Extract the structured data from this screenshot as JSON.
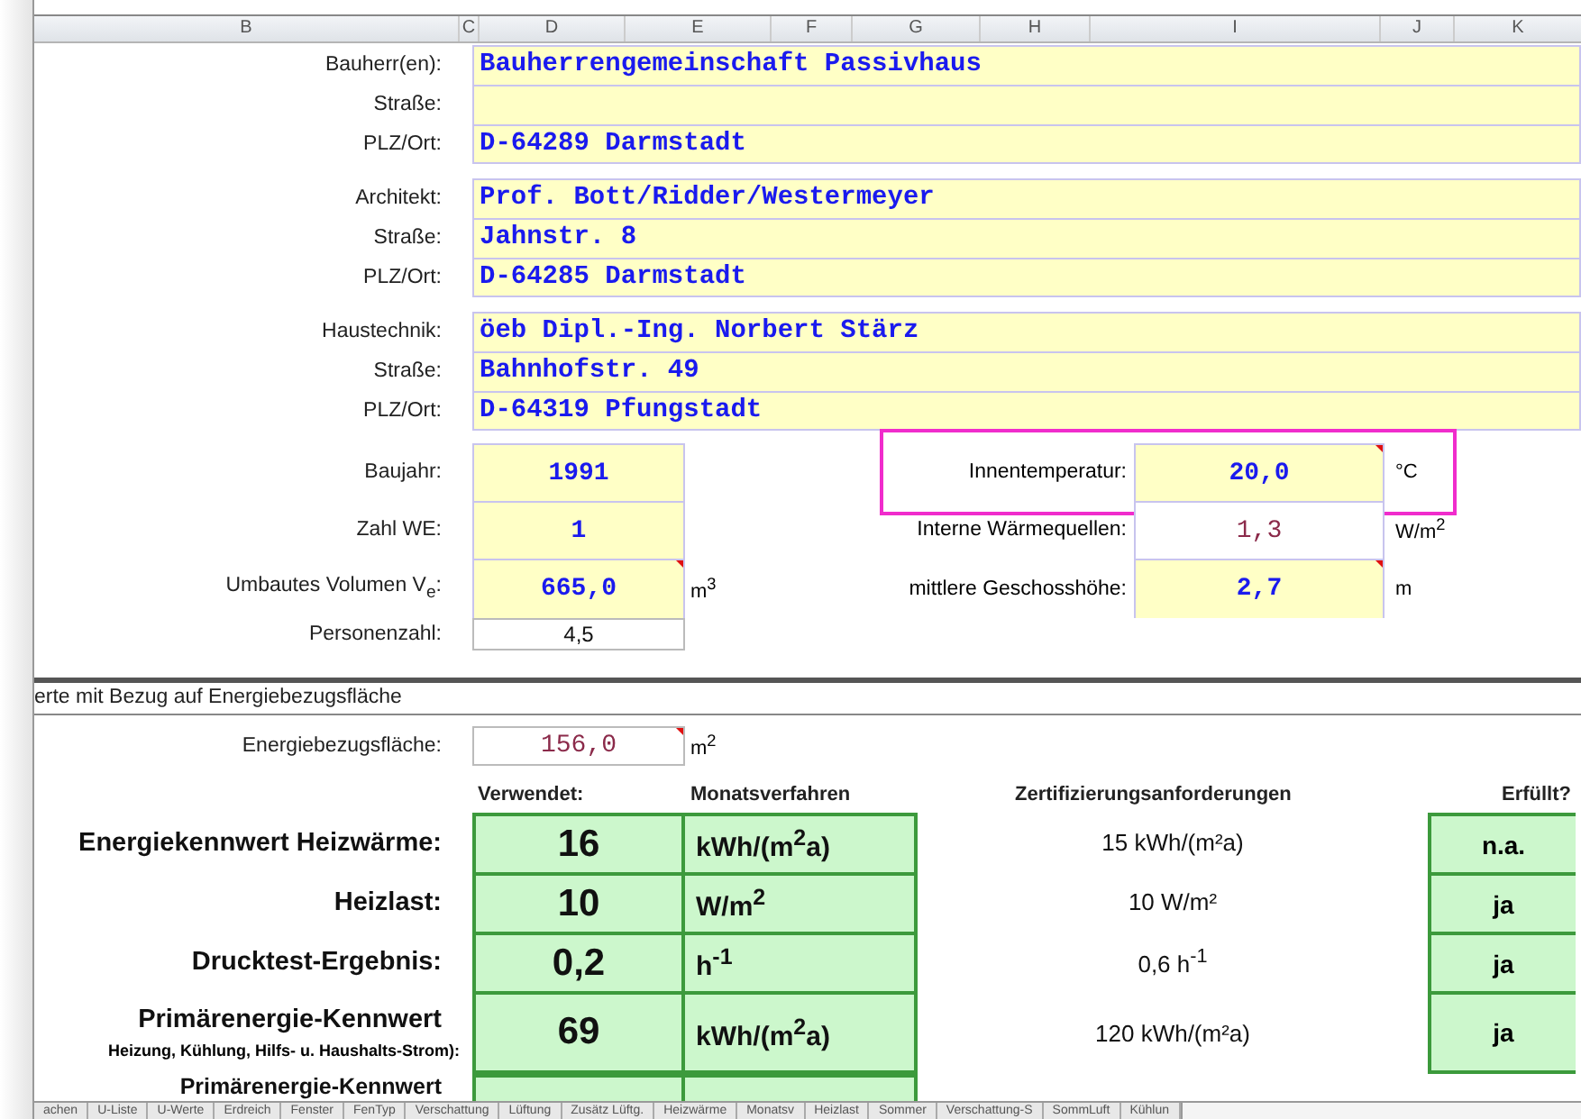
{
  "column_headers": [
    {
      "label": "B"
    },
    {
      "label": "C"
    },
    {
      "label": "D"
    },
    {
      "label": "E"
    },
    {
      "label": "F"
    },
    {
      "label": "G"
    },
    {
      "label": "H"
    },
    {
      "label": "I"
    },
    {
      "label": "J"
    },
    {
      "label": "K"
    }
  ],
  "contact_groups": [
    {
      "rows": [
        {
          "label": "Bauherr(en):",
          "value": "Bauherrengemeinschaft Passivhaus"
        },
        {
          "label": "Straße:"
        },
        {
          "label": "PLZ/Ort:",
          "value": "D-64289 Darmstadt"
        }
      ]
    },
    {
      "rows": [
        {
          "label": "Architekt:",
          "value": "Prof. Bott/Ridder/Westermeyer"
        },
        {
          "label": "Straße:",
          "value": "Jahnstr. 8"
        },
        {
          "label": "PLZ/Ort:",
          "value": "D-64285 Darmstadt"
        }
      ]
    },
    {
      "rows": [
        {
          "label": "Haustechnik:",
          "value": "öeb Dipl.-Ing. Norbert Stärz"
        },
        {
          "label": "Straße:",
          "value": "Bahnhofstr. 49"
        },
        {
          "label": "PLZ/Ort:",
          "value": "D-64319 Pfungstadt"
        }
      ]
    }
  ],
  "building_rows": [
    {
      "left": {
        "label": "Baujahr:",
        "value": "1991",
        "kind": "input",
        "note": false
      },
      "right": {
        "label": "Innentemperatur:",
        "value": "20,0",
        "unit": "°C",
        "kind": "input",
        "note": true,
        "highlighted": true
      }
    },
    {
      "left": {
        "label": "Zahl WE:",
        "value": "1",
        "kind": "input",
        "note": false
      },
      "right": {
        "label": "Interne Wärmequellen:",
        "value": "1,3",
        "unit": "W/m$^{2}$",
        "kind": "computed",
        "note": false,
        "highlighted": false
      }
    },
    {
      "left": {
        "label": "Umbautes Volumen V$_{e}$:",
        "value": "665,0",
        "unit": "m$^{3}$",
        "kind": "input",
        "note": true
      },
      "right": {
        "label": "mittlere Geschosshöhe:",
        "value": "2,7",
        "unit": "m",
        "kind": "input",
        "note": true,
        "highlighted": false
      }
    },
    {
      "left": {
        "label": "Personenzahl:",
        "value": "4,5",
        "kind": "plain",
        "note": false
      }
    }
  ],
  "section_title": "erte mit Bezug auf Energiebezugsfläche",
  "reference_area": {
    "label": "Energiebezugsfläche:",
    "value": "156,0",
    "unit": "m$^{2}$",
    "kind": "computed",
    "note": true
  },
  "results": {
    "headers": [
      "Verwendet:",
      "Monatsverfahren",
      "Zertifizierungsanforderungen",
      "Erfüllt?"
    ],
    "rows": [
      {
        "label": "Energiekennwert Heizwärme:",
        "value": "16",
        "unit": "kWh/(m$^{2}$a)",
        "requirement": "15 kWh/(m²a)",
        "fulfilled": "n.a."
      },
      {
        "label": "Heizlast:",
        "value": "10",
        "unit": "W/m$^{2}$",
        "requirement": "10 W/m²",
        "fulfilled": "ja"
      },
      {
        "label": "Drucktest-Ergebnis:",
        "value": "0,2",
        "unit": "h$^{-1}$",
        "requirement": "0,6 h$^{-1}$",
        "fulfilled": "ja"
      },
      {
        "label": "Primärenergie-Kennwert",
        "sublabel": "Heizung, Kühlung, Hilfs- u. Haushalts-Strom):",
        "value": "69",
        "unit": "kWh/(m$^{2}$a)",
        "requirement": "120 kWh/(m²a)",
        "fulfilled": "ja"
      },
      {
        "label": "Primärenergie-Kennwert"
      }
    ]
  },
  "sheet_tabs": [
    {
      "label": "achen",
      "selected": false
    },
    {
      "label": "U-Liste",
      "selected": false
    },
    {
      "label": "U-Werte",
      "selected": false
    },
    {
      "label": "Erdreich",
      "selected": false
    },
    {
      "label": "Fenster",
      "selected": false
    },
    {
      "label": "FenTyp",
      "selected": false
    },
    {
      "label": "Verschattung",
      "selected": false
    },
    {
      "label": "Lüftung",
      "selected": false
    },
    {
      "label": "Zusätz Lüftg.",
      "selected": false
    },
    {
      "label": "Heizwärme",
      "selected": false
    },
    {
      "label": "Monatsv",
      "selected": false
    },
    {
      "label": "Heizlast",
      "selected": false
    },
    {
      "label": "Sommer",
      "selected": false
    },
    {
      "label": "Verschattung-S",
      "selected": false
    },
    {
      "label": "SommLuft",
      "selected": false
    },
    {
      "label": "Kühlun",
      "selected": false
    }
  ]
}
